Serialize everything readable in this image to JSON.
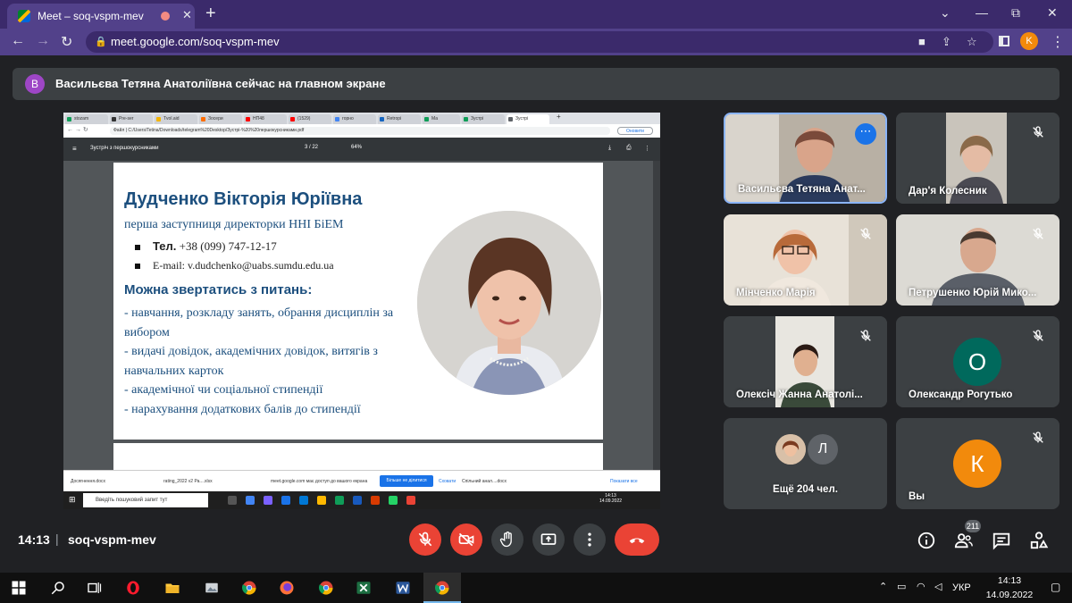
{
  "browser": {
    "tab_title": "Meet – soq-vspm-mev",
    "url": "meet.google.com/soq-vspm-mev",
    "profile_initial": "K",
    "window_controls": [
      "⌄",
      "—",
      "⧉",
      "✕"
    ]
  },
  "banner": {
    "avatar_initial": "В",
    "text": "Васильєва Тетяна Анатоліївна сейчас на главном экране"
  },
  "shared_screen": {
    "inner_tabs": [
      "stozam",
      "Pre-ser",
      "Тvol.aid",
      "Зосери",
      "НП48",
      "(1529)",
      "горно",
      "Retropi",
      "Ма",
      "Зустрі",
      "Зустрі"
    ],
    "inner_url": "Файл | C:/Users/Tetina/Downloads/telegram%20Desktop/Зустрі-%20%20першокурсниками.pdf",
    "inner_open_button": "Оновити",
    "pdf_title": "Зустріч з першокурсниками",
    "pdf_page": "3 / 22",
    "pdf_zoom": "64%",
    "slide": {
      "name": "Дудченко Вікторія Юріївна",
      "role": "перша заступниця директорки ННІ БіЕМ",
      "tel_label": "Тел.",
      "tel_value": " +38 (099) 747-12-17",
      "email": "E-mail: v.dudchenko@uabs.sumdu.edu.ua",
      "heading": "Можна звертатись з питань:",
      "items": [
        "- навчання, розкладу занять, обрання дисциплін за вибором",
        "- видачі довідок, академічних довідок, витягів з навчальних карток",
        "- академічної чи соціальної стипендії",
        "- нарахування додаткових балів до стипендії"
      ]
    },
    "downloads": [
      "Досягнення.docx",
      "rating_2022 v2 Ра....xlsx",
      "meet.google.com має доступ до вашого екрана",
      "Спільний анал....docx",
      "Показати все"
    ],
    "share_stop_button": "Більше не ділитися",
    "share_hide": "Сховати",
    "win_search": "Введіть пошуковий запит тут",
    "win_clock": "14:13",
    "win_date": "14.09.2022"
  },
  "participants": [
    {
      "name": "Васильєва Тетяна Анат...",
      "mic": "on"
    },
    {
      "name": "Дар'я Колесник",
      "mic": "off"
    },
    {
      "name": "Мінченко Марія",
      "mic": "off"
    },
    {
      "name": "Петрушенко Юрій Мико...",
      "mic": "off"
    },
    {
      "name": "Олексіч Жанна Анатолі...",
      "mic": "off"
    },
    {
      "name": "Олександр Рогутько",
      "mic": "off",
      "avatar": "О",
      "color": "#00695c"
    },
    {
      "name": "Ещё 204 чел.",
      "avatar": "Л",
      "color": "#5f6368"
    },
    {
      "name": "Вы",
      "mic": "off",
      "avatar": "К",
      "color": "#f28a0c"
    }
  ],
  "meeting": {
    "time": "14:13",
    "separator": "|",
    "code": "soq-vspm-mev",
    "people_count": "211"
  },
  "taskbar": {
    "lang": "УКР",
    "time": "14:13",
    "date": "14.09.2022"
  },
  "colors": {
    "accent": "#1a73e8",
    "danger": "#ea4335",
    "surface": "#3c4043",
    "background": "#202124"
  }
}
